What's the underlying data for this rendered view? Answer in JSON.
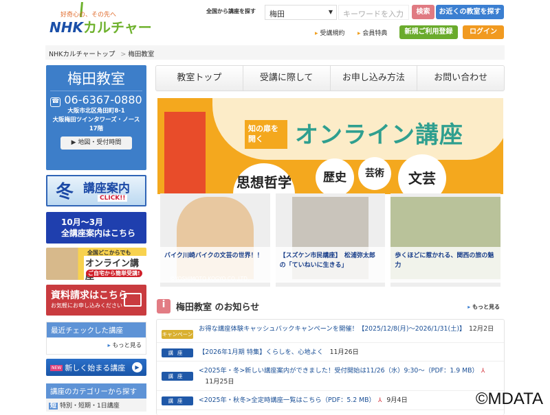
{
  "header": {
    "logo_tagline": "好奇心の、その先へ",
    "logo_nhk": "NHK",
    "logo_culture": "カルチャー",
    "search_label": "全国から講座を探す",
    "classroom_select": "梅田",
    "keyword_placeholder": "キーワードを入力",
    "search_button": "検索",
    "nearby_button": "お近くの教室を探す",
    "links": [
      "受講規約",
      "会員特典"
    ],
    "register_button": "新規ご利用登録",
    "login_button": "ログイン"
  },
  "breadcrumb": [
    "NHKカルチャートップ",
    "梅田教室"
  ],
  "breadcrumb_sep": ">",
  "classroom": {
    "name": "梅田教室",
    "phone": "06-6367-0880",
    "phone_icon": "☎",
    "address": [
      "大阪市北区角田町8-1",
      "大阪梅田ツインタワーズ・ノース",
      "17階"
    ],
    "map_button": "地図・受付時間"
  },
  "sidebar": {
    "winter_banner": {
      "big": "冬",
      "text": "講座案内",
      "click": "CLICK!!"
    },
    "season_banner": [
      "10月～3月",
      "全講座案内はこちら"
    ],
    "online_banner": {
      "top": "全国どこからでも",
      "main": "オンライン講座",
      "sub": "ご自宅から簡単受講!"
    },
    "document_banner": {
      "main": "資料請求はこちら",
      "sub": "お気軽にお申し込みください"
    },
    "recent": {
      "title": "最近チェックした講座",
      "more": "もっと見る"
    },
    "new_courses": {
      "badge": "NEW",
      "label": "新しく始まる講座"
    },
    "category": {
      "title": "講座のカテゴリーから探す",
      "item_icon": "短",
      "item": "特別・短期・1日講座"
    }
  },
  "tabs": [
    "教室トップ",
    "受講に際して",
    "お申し込み方法",
    "お問い合わせ"
  ],
  "banner": {
    "door": "知の扉を開く",
    "title": "オンライン講座",
    "topics": [
      "思想哲学",
      "歴史",
      "芸術",
      "文芸"
    ]
  },
  "cards": [
    {
      "caption": "バイク川崎バイクの文芸の世界！！",
      "credit": "©YOSHIMOTO KOGYO CO.,LTD."
    },
    {
      "caption": "【スズケン市民講座】　松浦弥太郎の「ていねいに生きる」"
    },
    {
      "caption": "歩くほどに惹かれる、関西の旅の魅力"
    }
  ],
  "notices": {
    "icon": "i",
    "title": "梅田教室 のお知らせ",
    "more": "もっと見る",
    "items": [
      {
        "badge": "キャンペーン",
        "text": "お得な講座体験キャッシュバックキャンペーンを開催！【2025/12/8(月)～2026/1/31(土)】",
        "date": "12月2日"
      },
      {
        "badge": "講座",
        "text": "【2026年1月期 特集】くらしを、心地よく",
        "date": "11月26日"
      },
      {
        "badge": "講座",
        "text": "<2025年・冬>新しい講座案内ができました！受付開始は11/26（水）9:30～（PDF：1.9 MB）",
        "date": "11月25日",
        "pdf": true
      },
      {
        "badge": "講座",
        "text": "<2025年・秋冬>全定時講座一覧はこちら（PDF：5.2 MB）",
        "date": "9月4日",
        "pdf": true
      }
    ]
  },
  "watermark": "©MDATA",
  "colors": {
    "blue": "#3d7ec9",
    "green": "#6aab2c",
    "orange": "#f19a20",
    "pink": "#e07a82"
  }
}
